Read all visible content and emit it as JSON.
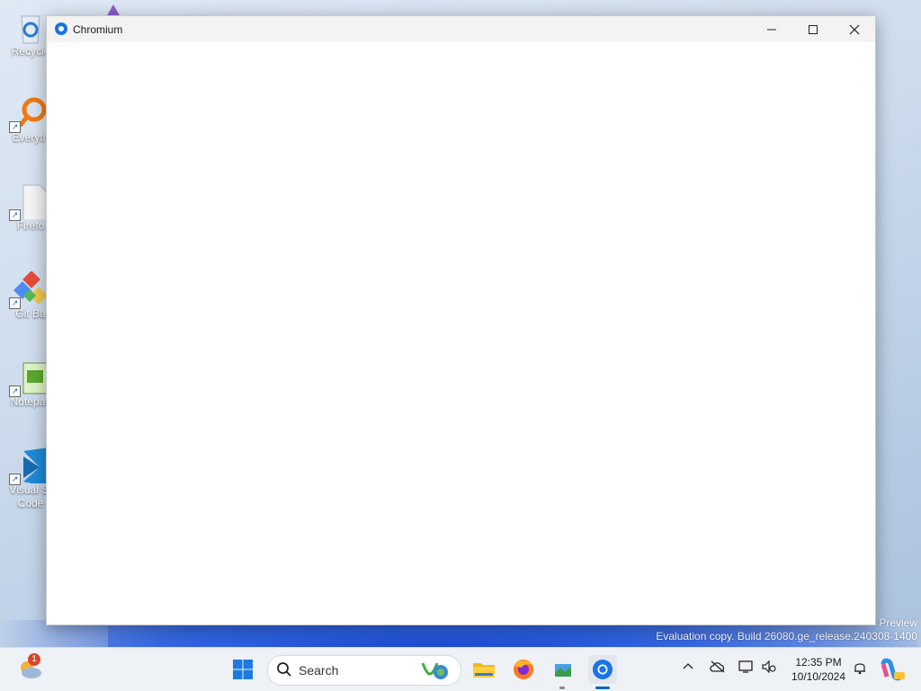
{
  "desktop": {
    "icons": [
      {
        "label": "Recycle"
      },
      {
        "label": "Everyth"
      },
      {
        "label": "Firefo"
      },
      {
        "label": "Git Ba"
      },
      {
        "label": "Notepac"
      },
      {
        "label": "Visual St",
        "label2": "Code"
      }
    ],
    "watermark": {
      "line1": "Preview",
      "line2": "Evaluation copy. Build 26080.ge_release.240308-1400"
    }
  },
  "window": {
    "title": "Chromium",
    "icon": "chromium-icon",
    "controls": {
      "minimize": "—",
      "maximize": "☐",
      "close": "✕"
    }
  },
  "taskbar": {
    "weather_badge": "1",
    "search_placeholder": "Search",
    "apps": [
      "start-icon",
      "file-explorer-icon",
      "firefox-icon",
      "app-icon",
      "chromium-icon"
    ],
    "clock": {
      "time": "12:35 PM",
      "date": "10/10/2024"
    }
  },
  "colors": {
    "accent": "#0067c0",
    "window_bg": "#ffffff",
    "taskbar_bg": "#eef1f6"
  }
}
